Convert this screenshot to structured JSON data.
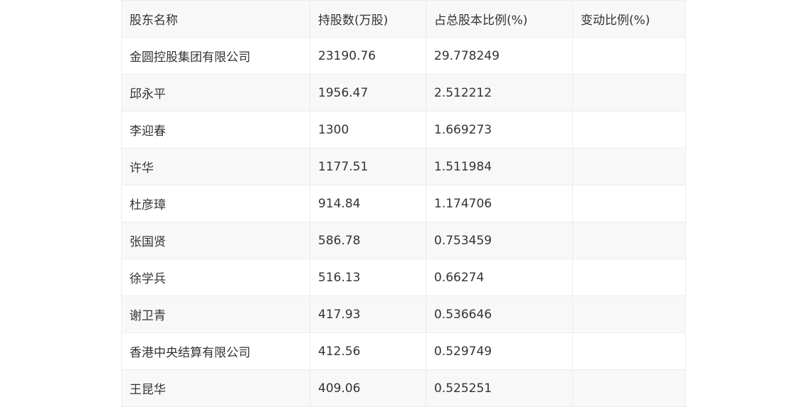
{
  "table": {
    "headers": [
      "股东名称",
      "持股数(万股)",
      "占总股本比例(%)",
      "变动比例(%)"
    ],
    "rows": [
      [
        "金圆控股集团有限公司",
        "23190.76",
        "29.778249",
        ""
      ],
      [
        "邱永平",
        "1956.47",
        "2.512212",
        ""
      ],
      [
        "李迎春",
        "1300",
        "1.669273",
        ""
      ],
      [
        "许华",
        "1177.51",
        "1.511984",
        ""
      ],
      [
        "杜彦璋",
        "914.84",
        "1.174706",
        ""
      ],
      [
        "张国贤",
        "586.78",
        "0.753459",
        ""
      ],
      [
        "徐学兵",
        "516.13",
        "0.66274",
        ""
      ],
      [
        "谢卫青",
        "417.93",
        "0.536646",
        ""
      ],
      [
        "香港中央结算有限公司",
        "412.56",
        "0.529749",
        ""
      ],
      [
        "王昆华",
        "409.06",
        "0.525251",
        ""
      ]
    ]
  }
}
